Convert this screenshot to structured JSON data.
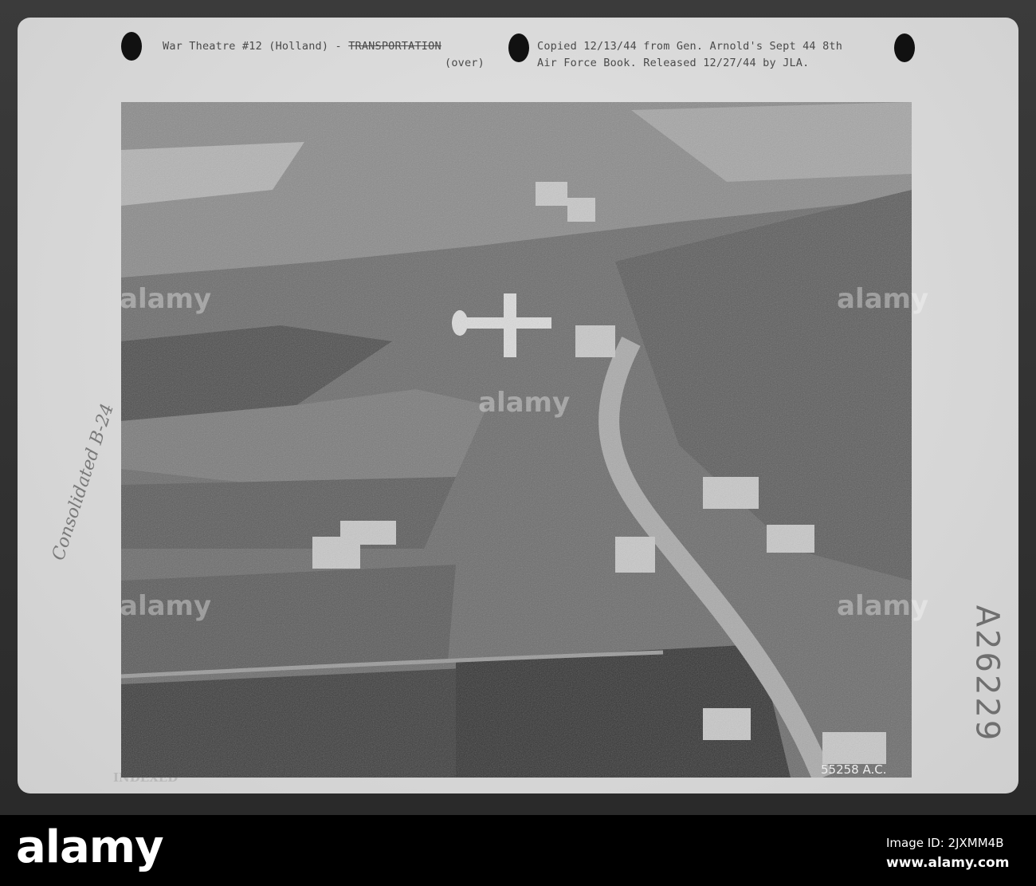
{
  "card": {
    "caption_line1_left": "War Theatre #12 (Holland) - ",
    "caption_line1_struck": "TRANSPORTATION",
    "caption_line2_left": "(over)",
    "caption_right_line1": "Copied 12/13/44 from Gen. Arnold's Sept 44 8th",
    "caption_right_line2": "Air Force Book. Released 12/27/44 by JLA.",
    "handwritten_left": "Consolidated B-24",
    "handwritten_right": "A26229",
    "stamp": "INDEXED",
    "negative_number": "55258  A.C."
  },
  "watermark": {
    "text": "alamy"
  },
  "footer": {
    "logo": "alamy",
    "image_id": "Image ID: 2JXMM4B",
    "url": "www.alamy.com"
  }
}
